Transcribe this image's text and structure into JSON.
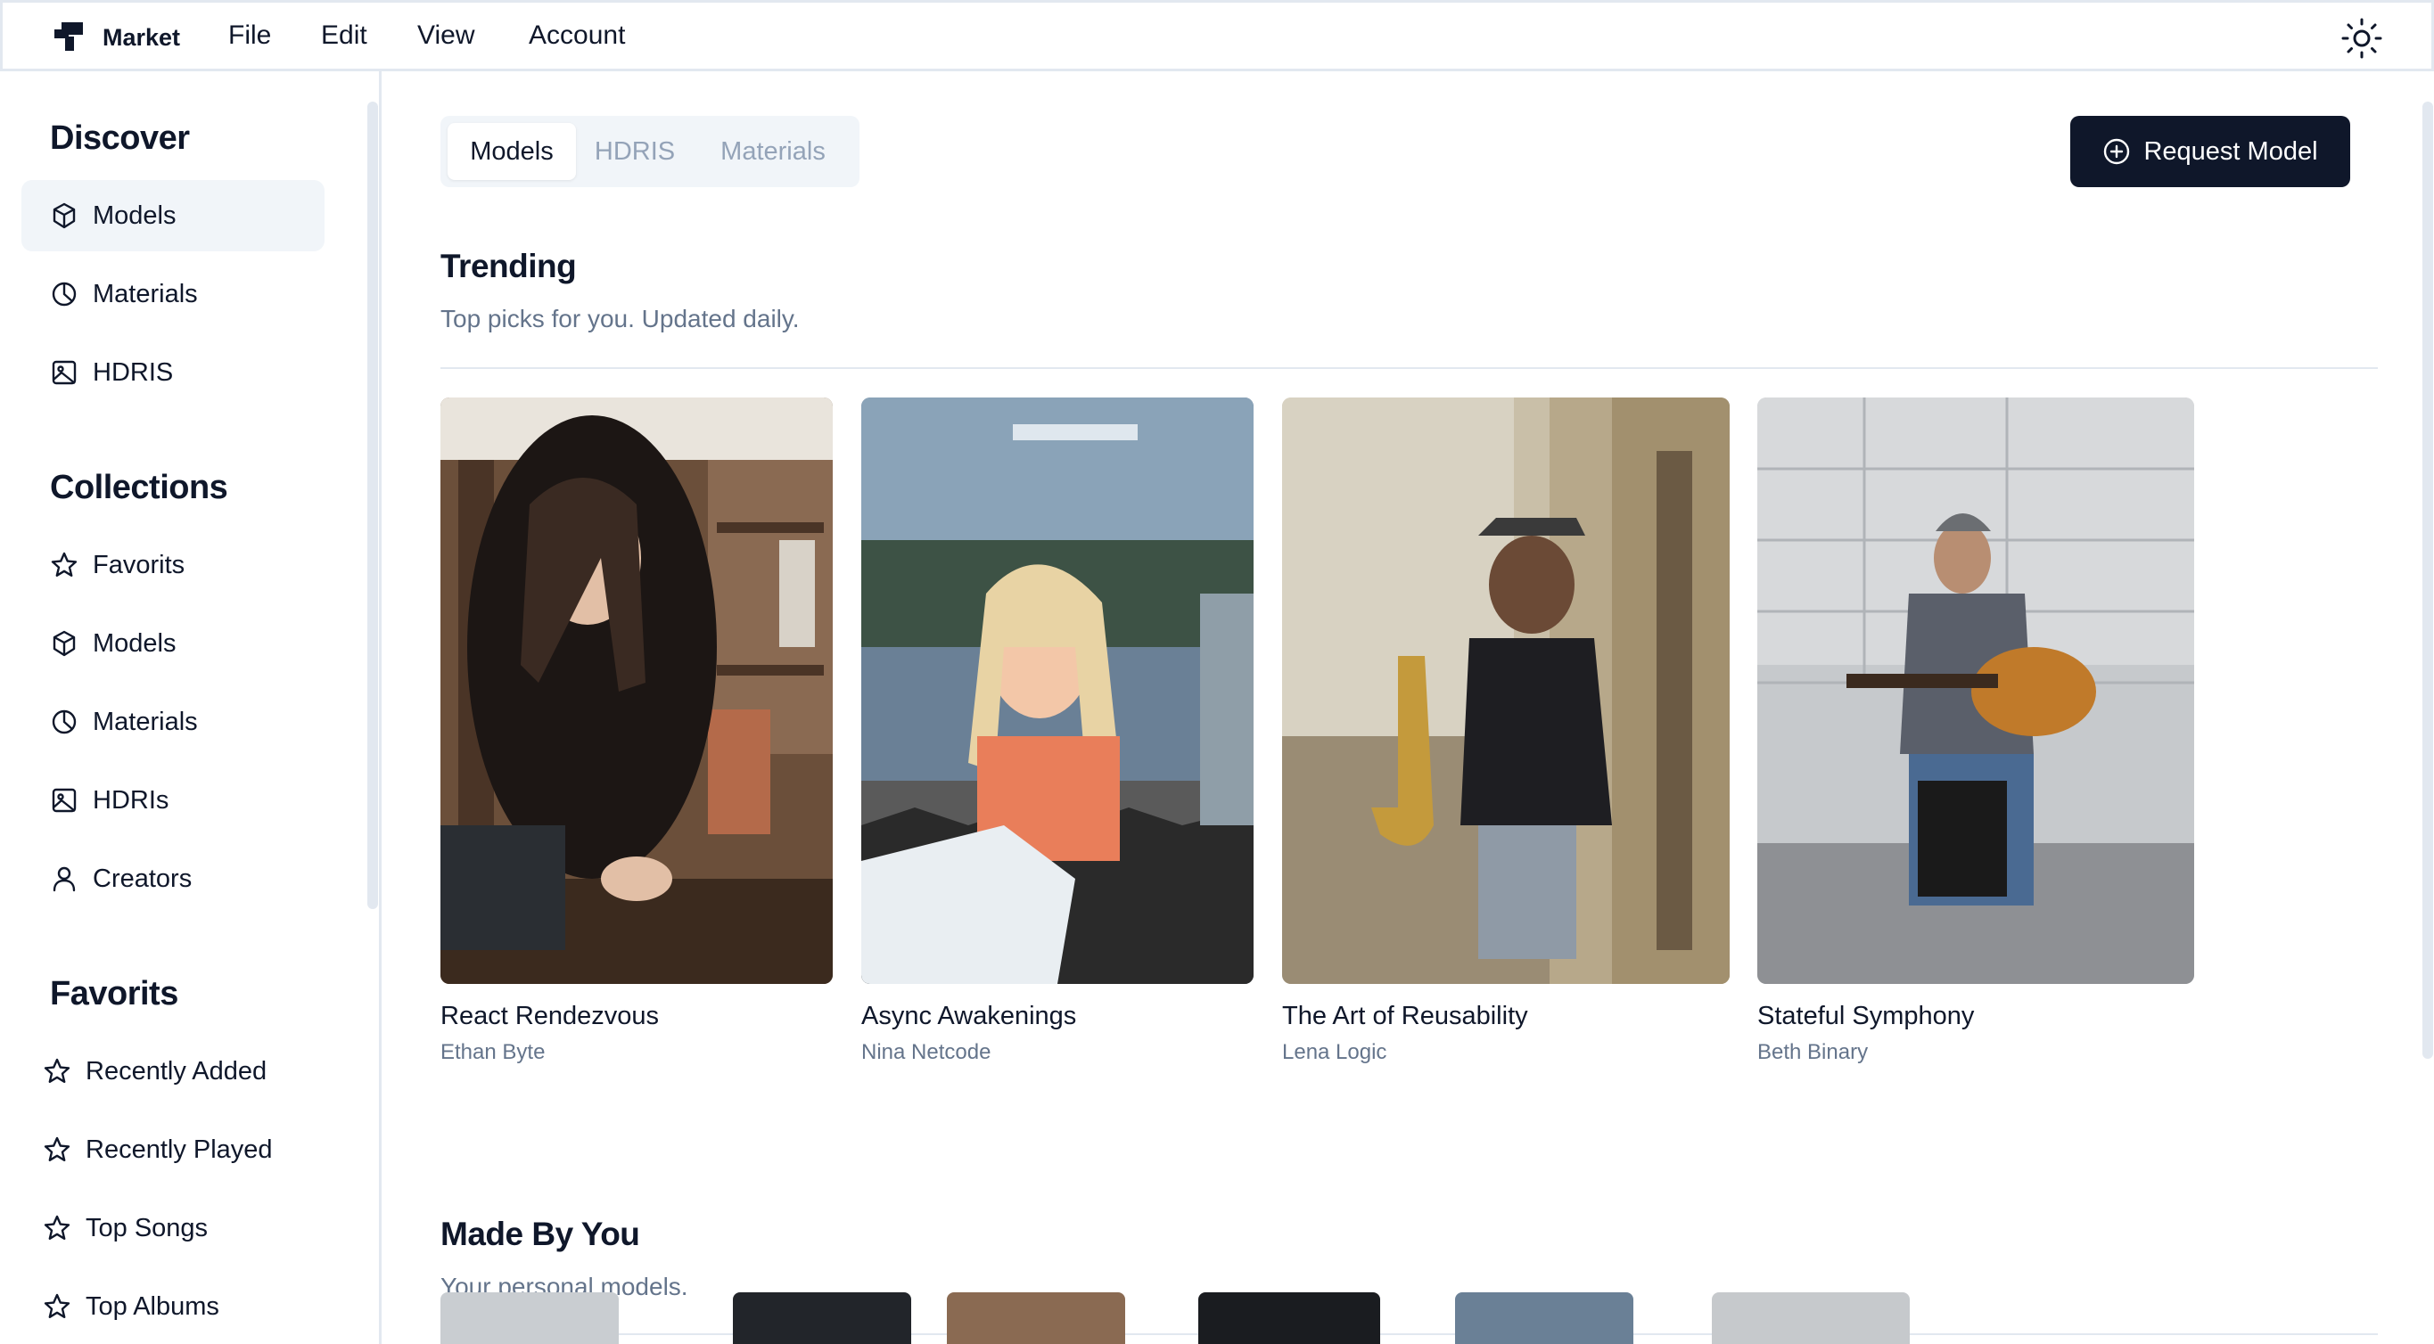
{
  "menubar": {
    "brand": "Market",
    "menus": [
      "File",
      "Edit",
      "View",
      "Account"
    ]
  },
  "sidebar": {
    "sections": [
      {
        "title": "Discover",
        "items": [
          {
            "label": "Models",
            "icon": "cube-icon"
          },
          {
            "label": "Materials",
            "icon": "pie-icon"
          },
          {
            "label": "HDRIS",
            "icon": "image-icon"
          }
        ]
      },
      {
        "title": "Collections",
        "items": [
          {
            "label": "Favorits",
            "icon": "star-icon"
          },
          {
            "label": "Models",
            "icon": "cube-icon"
          },
          {
            "label": "Materials",
            "icon": "pie-icon"
          },
          {
            "label": "HDRIs",
            "icon": "image-icon"
          },
          {
            "label": "Creators",
            "icon": "user-icon"
          }
        ]
      },
      {
        "title": "Favorits",
        "items": [
          {
            "label": "Recently Added",
            "icon": "star-icon"
          },
          {
            "label": "Recently Played",
            "icon": "star-icon"
          },
          {
            "label": "Top Songs",
            "icon": "star-icon"
          },
          {
            "label": "Top Albums",
            "icon": "star-icon"
          }
        ]
      }
    ]
  },
  "tabs": [
    "Models",
    "HDRIS",
    "Materials"
  ],
  "request_button": "Request Model",
  "trending": {
    "title": "Trending",
    "subtitle": "Top picks for you. Updated daily.",
    "cards": [
      {
        "title": "React Rendezvous",
        "author": "Ethan Byte"
      },
      {
        "title": "Async Awakenings",
        "author": "Nina Netcode"
      },
      {
        "title": "The Art of Reusability",
        "author": "Lena Logic"
      },
      {
        "title": "Stateful Symphony",
        "author": "Beth Binary"
      }
    ]
  },
  "made_by_you": {
    "title": "Made By You",
    "subtitle": "Your personal models."
  },
  "colors": {
    "primary": "#0f172a",
    "muted": "#64748b",
    "border": "#e2e8f0",
    "active_bg": "#f1f5f9"
  }
}
